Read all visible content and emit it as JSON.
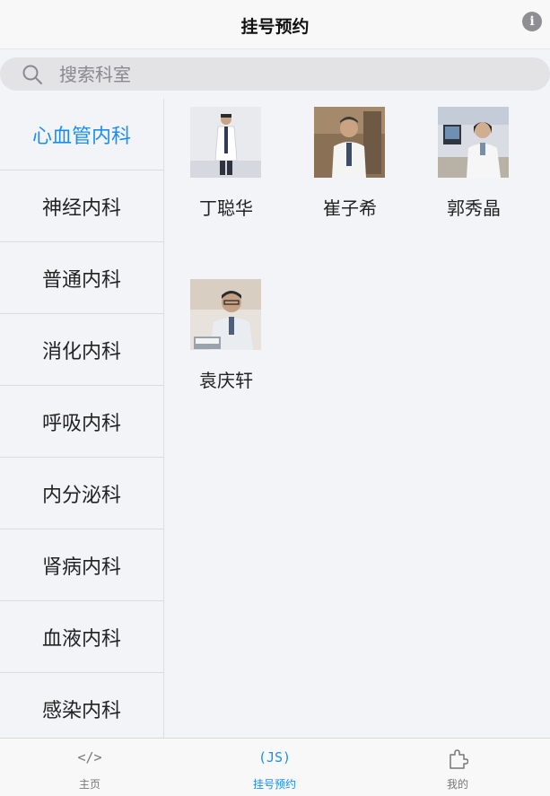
{
  "header": {
    "title": "挂号预约",
    "info_icon": "info-icon",
    "info_glyph": "i"
  },
  "search": {
    "placeholder": "搜索科室",
    "value": ""
  },
  "departments": [
    {
      "label": "心血管内科",
      "selected": true
    },
    {
      "label": "神经内科",
      "selected": false
    },
    {
      "label": "普通内科",
      "selected": false
    },
    {
      "label": "消化内科",
      "selected": false
    },
    {
      "label": "呼吸内科",
      "selected": false
    },
    {
      "label": "内分泌科",
      "selected": false
    },
    {
      "label": "肾病内科",
      "selected": false
    },
    {
      "label": "血液内科",
      "selected": false
    },
    {
      "label": "感染内科",
      "selected": false
    }
  ],
  "doctors": [
    {
      "name": "丁聪华",
      "photo": "doctor-photo"
    },
    {
      "name": "崔子希",
      "photo": "doctor-photo"
    },
    {
      "name": "郭秀晶",
      "photo": "doctor-photo"
    },
    {
      "name": "袁庆轩",
      "photo": "doctor-photo"
    }
  ],
  "tabbar": {
    "items": [
      {
        "label": "主页",
        "icon": "code-icon",
        "glyph": "</>",
        "active": false
      },
      {
        "label": "挂号预约",
        "icon": "js-icon",
        "glyph": "(JS)",
        "active": true
      },
      {
        "label": "我的",
        "icon": "puzzle-icon",
        "glyph": "",
        "active": false
      }
    ]
  },
  "colors": {
    "accent": "#1a8ef0",
    "background": "#f3f4f7",
    "text": "#222222"
  }
}
